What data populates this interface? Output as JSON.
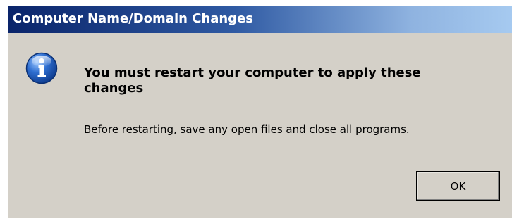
{
  "window": {
    "title": "Computer Name/Domain Changes"
  },
  "dialog": {
    "icon": "info-icon",
    "heading": "You must restart your computer to apply these changes",
    "message": "Before restarting, save any open files and close all programs.",
    "ok_label": "OK"
  },
  "colors": {
    "titlebar_start": "#0a246a",
    "titlebar_end": "#a6caf0",
    "dialog_background": "#d4d0c8",
    "icon_blue": "#1e5ab8"
  }
}
